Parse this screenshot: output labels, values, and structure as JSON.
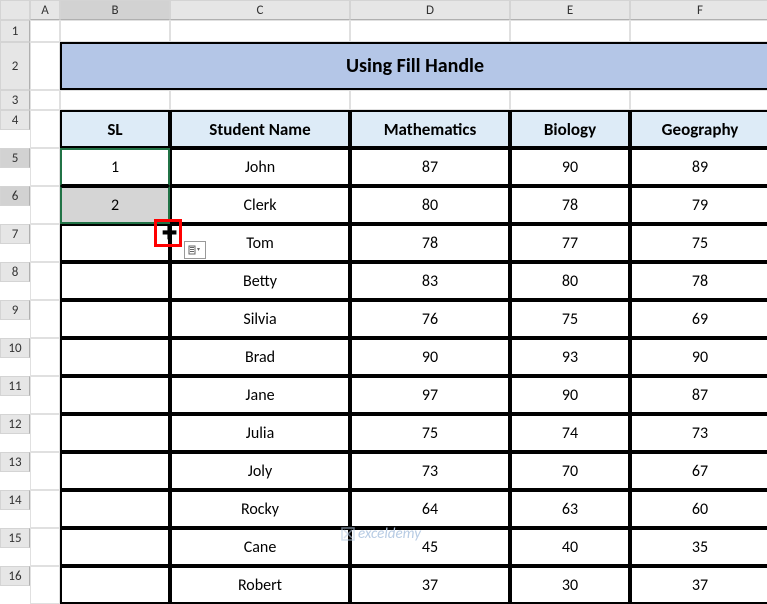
{
  "columns": [
    "A",
    "B",
    "C",
    "D",
    "E",
    "F"
  ],
  "row_numbers": [
    1,
    2,
    3,
    4,
    5,
    6,
    7,
    8,
    9,
    10,
    11,
    12,
    13,
    14,
    15,
    16
  ],
  "title": "Using Fill Handle",
  "headers": {
    "sl": "SL",
    "name": "Student Name",
    "math": "Mathematics",
    "bio": "Biology",
    "geo": "Geography"
  },
  "rows": [
    {
      "sl": "1",
      "name": "John",
      "math": "87",
      "bio": "90",
      "geo": "89"
    },
    {
      "sl": "2",
      "name": "Clerk",
      "math": "80",
      "bio": "78",
      "geo": "79"
    },
    {
      "sl": "",
      "name": "Tom",
      "math": "78",
      "bio": "77",
      "geo": "75"
    },
    {
      "sl": "",
      "name": "Betty",
      "math": "83",
      "bio": "80",
      "geo": "78"
    },
    {
      "sl": "",
      "name": "Silvia",
      "math": "76",
      "bio": "75",
      "geo": "69"
    },
    {
      "sl": "",
      "name": "Brad",
      "math": "90",
      "bio": "93",
      "geo": "90"
    },
    {
      "sl": "",
      "name": "Jane",
      "math": "97",
      "bio": "90",
      "geo": "87"
    },
    {
      "sl": "",
      "name": "Julia",
      "math": "75",
      "bio": "74",
      "geo": "73"
    },
    {
      "sl": "",
      "name": "Joly",
      "math": "73",
      "bio": "70",
      "geo": "67"
    },
    {
      "sl": "",
      "name": "Rocky",
      "math": "64",
      "bio": "63",
      "geo": "60"
    },
    {
      "sl": "",
      "name": "Cane",
      "math": "45",
      "bio": "40",
      "geo": "35"
    },
    {
      "sl": "",
      "name": "Robert",
      "math": "37",
      "bio": "30",
      "geo": "37"
    }
  ],
  "watermark": "exceldemy",
  "chart_data": {
    "type": "table",
    "title": "Using Fill Handle",
    "columns": [
      "SL",
      "Student Name",
      "Mathematics",
      "Biology",
      "Geography"
    ],
    "rows": [
      [
        1,
        "John",
        87,
        90,
        89
      ],
      [
        2,
        "Clerk",
        80,
        78,
        79
      ],
      [
        null,
        "Tom",
        78,
        77,
        75
      ],
      [
        null,
        "Betty",
        83,
        80,
        78
      ],
      [
        null,
        "Silvia",
        76,
        75,
        69
      ],
      [
        null,
        "Brad",
        90,
        93,
        90
      ],
      [
        null,
        "Jane",
        97,
        90,
        87
      ],
      [
        null,
        "Julia",
        75,
        74,
        73
      ],
      [
        null,
        "Joly",
        73,
        70,
        67
      ],
      [
        null,
        "Rocky",
        64,
        63,
        60
      ],
      [
        null,
        "Cane",
        45,
        40,
        35
      ],
      [
        null,
        "Robert",
        37,
        30,
        37
      ]
    ]
  }
}
